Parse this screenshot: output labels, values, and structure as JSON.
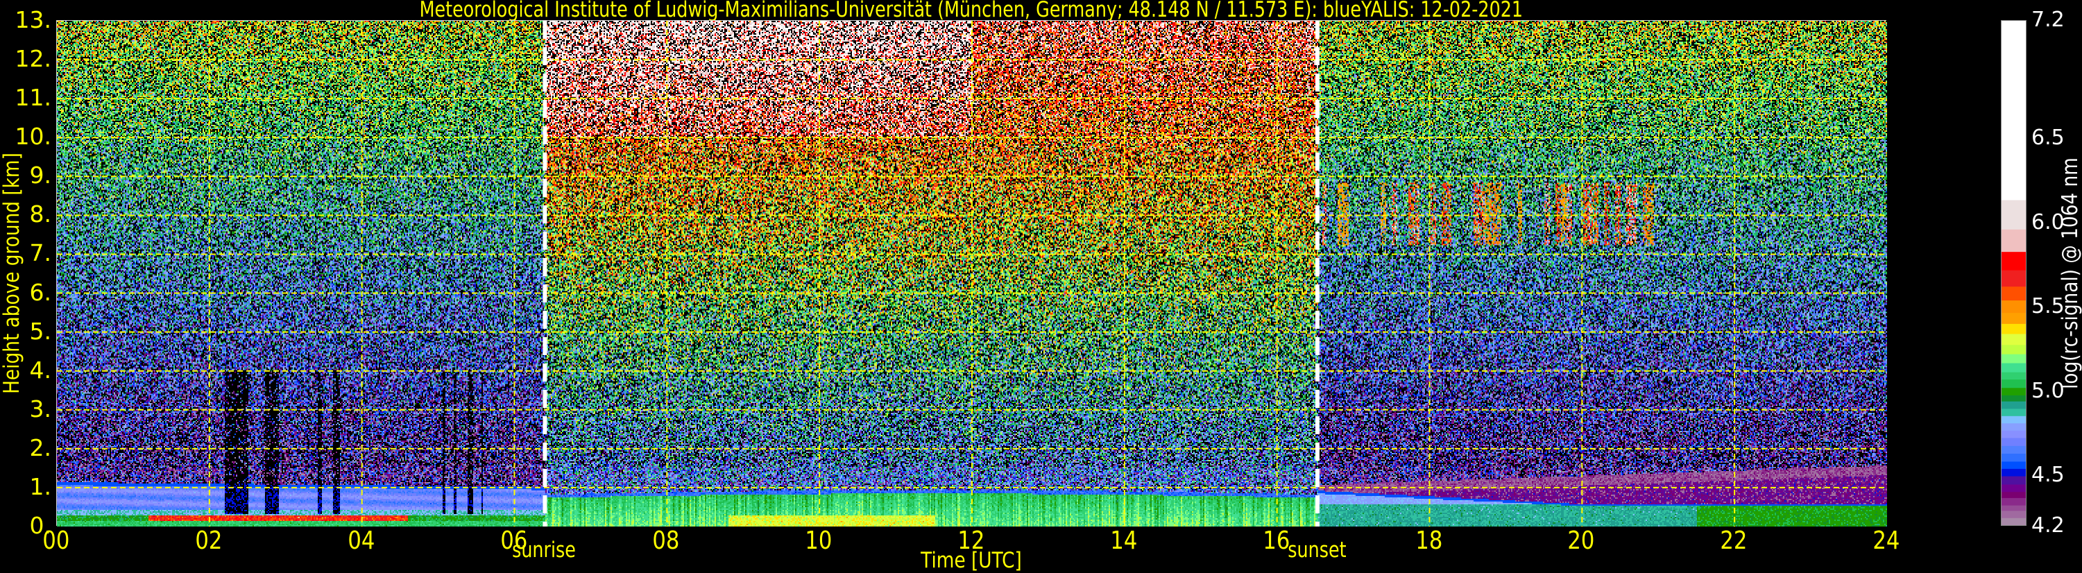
{
  "chart_data": {
    "type": "heatmap",
    "title": "Meteorological Institute of Ludwig-Maximilians-Universität (München, Germany; 48.148 N / 11.573 E):    blueYALIS: 12-02-2021",
    "xlabel": "Time [UTC]",
    "ylabel": "Height above ground [km]",
    "xlim": [
      0,
      24
    ],
    "ylim": [
      0,
      13
    ],
    "xticks": [
      0,
      2,
      4,
      6,
      8,
      10,
      12,
      14,
      16,
      18,
      20,
      22,
      24
    ],
    "xtick_labels": [
      "00",
      "02",
      "04",
      "06",
      "08",
      "10",
      "12",
      "14",
      "16",
      "18",
      "20",
      "22",
      "24"
    ],
    "yticks": [
      0,
      1,
      2,
      3,
      4,
      5,
      6,
      7,
      8,
      9,
      10,
      11,
      12,
      13
    ],
    "ytick_labels": [
      "0.",
      "1.",
      "2.",
      "3.",
      "4.",
      "5.",
      "6.",
      "7.",
      "8.",
      "9.",
      "10.",
      "11.",
      "12.",
      "13."
    ],
    "grid": true,
    "grid_color": "#ffff00",
    "annotations": [
      {
        "label": "sunrise",
        "time": 6.4
      },
      {
        "label": "sunset",
        "time": 16.53
      }
    ],
    "colorbar": {
      "label": "log(rc-signal) @ 1064 nm",
      "range": [
        4.2,
        7.2
      ],
      "ticks": [
        4.2,
        4.5,
        5.0,
        5.5,
        6.0,
        6.5,
        7.2
      ],
      "tick_labels": [
        "4.2",
        "4.5",
        "5.0",
        "5.5",
        "6.0",
        "6.5",
        "7.2"
      ],
      "colormap": [
        {
          "min": 4.2,
          "color": "#a88aa8"
        },
        {
          "min": 4.248,
          "color": "#a06aa0"
        },
        {
          "min": 4.291,
          "color": "#964c96"
        },
        {
          "min": 4.323,
          "color": "#8a2a8a"
        },
        {
          "min": 4.367,
          "color": "#7a0070"
        },
        {
          "min": 4.403,
          "color": "#700090"
        },
        {
          "min": 4.447,
          "color": "#5010a0"
        },
        {
          "min": 4.496,
          "color": "#0010e0"
        },
        {
          "min": 4.54,
          "color": "#0050ff"
        },
        {
          "min": 4.583,
          "color": "#3070ff"
        },
        {
          "min": 4.63,
          "color": "#5080ff"
        },
        {
          "min": 4.676,
          "color": "#7080ff"
        },
        {
          "min": 4.723,
          "color": "#8890ff"
        },
        {
          "min": 4.767,
          "color": "#88a0ff"
        },
        {
          "min": 4.81,
          "color": "#80c0ff"
        },
        {
          "min": 4.853,
          "color": "#30c0a0"
        },
        {
          "min": 4.896,
          "color": "#20a090"
        },
        {
          "min": 4.94,
          "color": "#109030"
        },
        {
          "min": 4.976,
          "color": "#20a000"
        },
        {
          "min": 5.02,
          "color": "#20c050"
        },
        {
          "min": 5.07,
          "color": "#30d070"
        },
        {
          "min": 5.113,
          "color": "#40e090"
        },
        {
          "min": 5.167,
          "color": "#80ff80"
        },
        {
          "min": 5.22,
          "color": "#c0ff40"
        },
        {
          "min": 5.275,
          "color": "#e0ff40"
        },
        {
          "min": 5.34,
          "color": "#ffe000"
        },
        {
          "min": 5.4,
          "color": "#ffa000"
        },
        {
          "min": 5.465,
          "color": "#ff9000"
        },
        {
          "min": 5.539,
          "color": "#ff5000"
        },
        {
          "min": 5.621,
          "color": "#f02020"
        },
        {
          "min": 5.718,
          "color": "#ff0000"
        },
        {
          "min": 5.827,
          "color": "#f0c0c0"
        },
        {
          "min": 5.96,
          "color": "#ece0e0"
        },
        {
          "min": 6.134,
          "color": "#ffffff"
        }
      ]
    }
  }
}
